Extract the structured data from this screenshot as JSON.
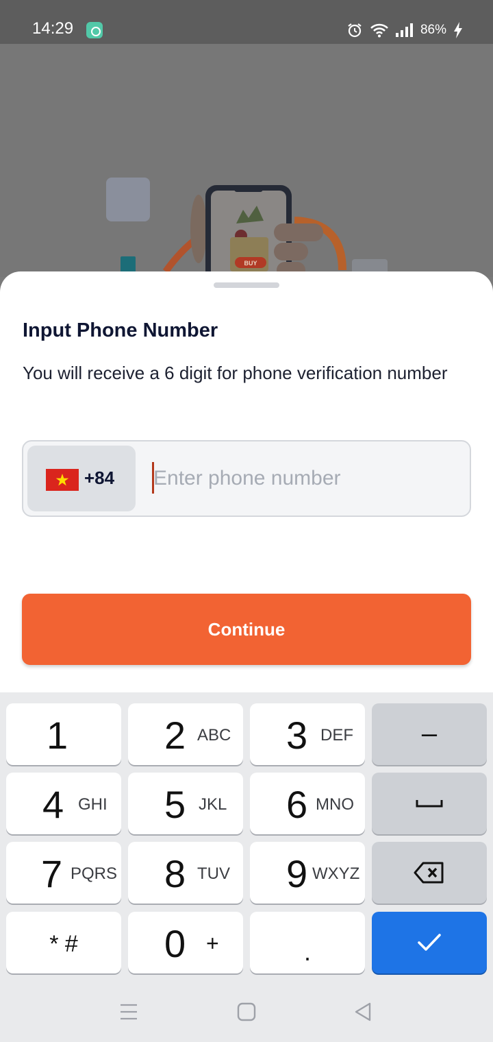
{
  "status_bar": {
    "time": "14:29",
    "battery": "86%",
    "icons": [
      "app-icon",
      "alarm-icon",
      "wifi-icon",
      "signal-icon",
      "battery-charging-icon"
    ]
  },
  "illustration": {
    "buy_label": "BUY"
  },
  "sheet": {
    "title": "Input Phone Number",
    "subtitle": "You will receive a 6 digit for phone verification number",
    "country": {
      "flag": "vietnam-flag-icon",
      "code": "+84"
    },
    "phone": {
      "value": "",
      "placeholder": "Enter phone number"
    },
    "continue_label": "Continue"
  },
  "keypad": {
    "keys": [
      {
        "digit": "1",
        "letters": ""
      },
      {
        "digit": "2",
        "letters": "ABC"
      },
      {
        "digit": "3",
        "letters": "DEF"
      },
      {
        "digit": "4",
        "letters": "GHI"
      },
      {
        "digit": "5",
        "letters": "JKL"
      },
      {
        "digit": "6",
        "letters": "MNO"
      },
      {
        "digit": "7",
        "letters": "PQRS"
      },
      {
        "digit": "8",
        "letters": "TUV"
      },
      {
        "digit": "9",
        "letters": "WXYZ"
      },
      {
        "digit": "0",
        "letters": "+"
      }
    ],
    "star_hash": "* #",
    "dot": ".",
    "minus": "–",
    "function_icons": [
      "space-icon",
      "backspace-icon",
      "checkmark-icon"
    ]
  },
  "nav": {
    "icons": [
      "recents-icon",
      "home-icon",
      "back-icon"
    ]
  },
  "colors": {
    "accent": "#f26333",
    "done_key": "#1e74e6",
    "title": "#0f1633"
  }
}
